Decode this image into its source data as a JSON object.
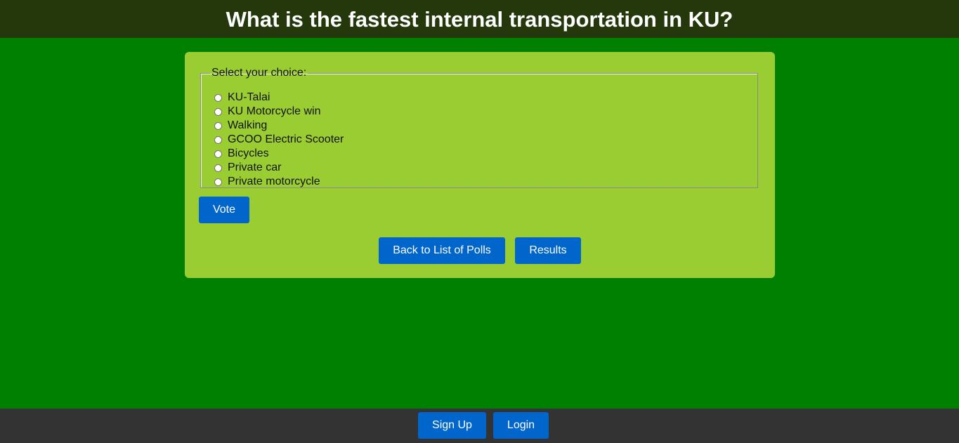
{
  "header": {
    "title": "What is the fastest internal transportation in KU?"
  },
  "poll": {
    "legend": "Select your choice:",
    "choices": [
      "KU-Talai",
      "KU Motorcycle win",
      "Walking",
      "GCOO Electric Scooter",
      "Bicycles",
      "Private car",
      "Private motorcycle"
    ],
    "vote_label": "Vote",
    "back_label": "Back to List of Polls",
    "results_label": "Results"
  },
  "footer": {
    "signup_label": "Sign Up",
    "login_label": "Login"
  },
  "colors": {
    "page_background": "#008000",
    "header_background": "#25380b",
    "card_background": "#9acd32",
    "button": "#0066cc",
    "footer_background": "#333333"
  }
}
